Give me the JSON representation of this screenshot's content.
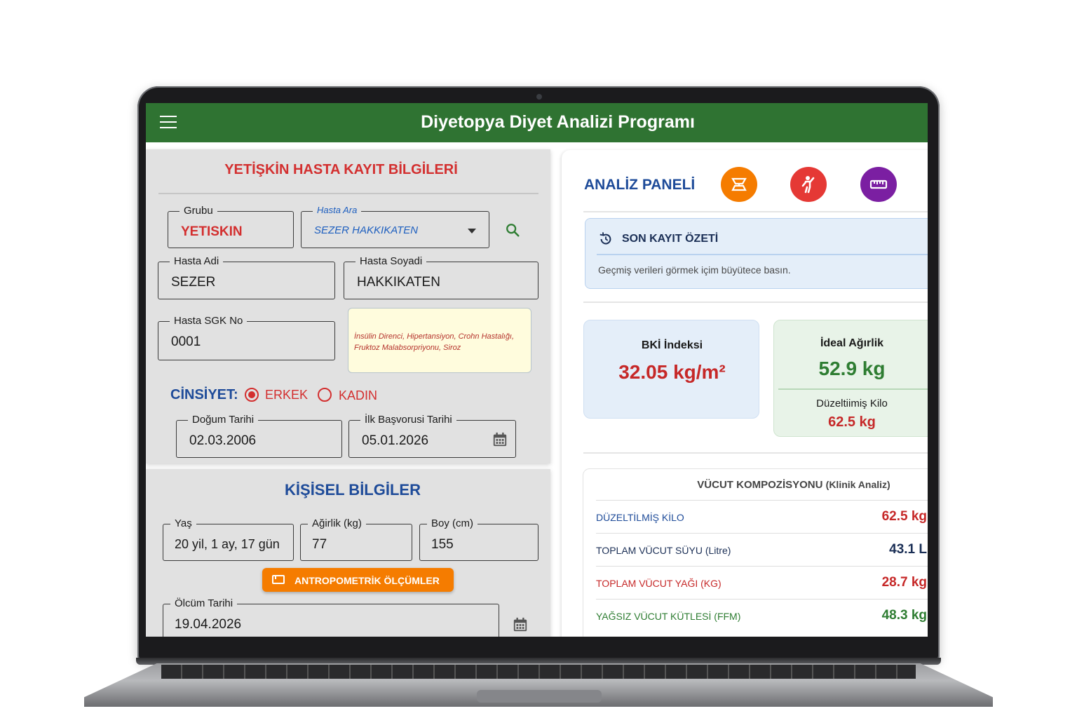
{
  "app": {
    "title": "Diyetopya Diyet Analizi Programı"
  },
  "patient_form": {
    "title": "YETİŞKİN HASTA KAYIT BİLGİLERİ",
    "group": {
      "label": "Grubu",
      "value": "YETISKIN"
    },
    "search": {
      "label": "Hasta Ara",
      "value": "SEZER HAKKIKATEN"
    },
    "first_name": {
      "label": "Hasta Adi",
      "value": "SEZER"
    },
    "last_name": {
      "label": "Hasta Soyadi",
      "value": "HAKKIKATEN"
    },
    "sgk_no": {
      "label": "Hasta SGK No",
      "value": "0001"
    },
    "conditions_note": "İnsülin Direnci, Hipertansiyon, Crohn Hastalığı, Fruktoz Malabsorpriyonu, Siroz",
    "gender": {
      "label": "CİNSİYET:",
      "options": [
        "ERKEK",
        "KADIN"
      ],
      "selected": "ERKEK"
    },
    "birth_date": {
      "label": "Doğum Tarihi",
      "value": "02.03.2006"
    },
    "first_visit": {
      "label": "İlk Başvorusi Tarihi",
      "value": "05.01.2026"
    }
  },
  "personal": {
    "title": "KİŞİSEL BİLGİLER",
    "age": {
      "label": "Yaş",
      "value": "20 yil, 1 ay, 17 gün"
    },
    "weight": {
      "label": "Ağirlik (kg)",
      "value": "77"
    },
    "height": {
      "label": "Boy (cm)",
      "value": "155"
    },
    "anthro_button": "ANTROPOMETRİK ÖLÇÜMLER",
    "measure_date": {
      "label": "Ölcüm Tarihi",
      "value": "19.04.2026"
    }
  },
  "analysis": {
    "title": "ANALİZ PANELİ",
    "icons": [
      {
        "name": "scale-icon",
        "color": "#f57c00"
      },
      {
        "name": "person-icon",
        "color": "#e53935"
      },
      {
        "name": "ruler-icon",
        "color": "#7b1fa2"
      }
    ],
    "summary": {
      "title": "SON KAYIT ÖZETİ",
      "text": "Geçmiş verileri görmek içim büyütece basın."
    },
    "bmi": {
      "label": "BKİ İndeksi",
      "value": "32.05 kg/m²"
    },
    "ideal": {
      "label": "İdeal Ağırlik",
      "value": "52.9 kg",
      "adj_label": "Düzeltiimiş Kilo",
      "adj_value": "62.5 kg"
    },
    "composition": {
      "title": "VÜCUT KOMPOZİSYONU",
      "subtitle": "(Klinik Analiz)",
      "rows": [
        {
          "key": "DÜZELTİLMİŞ KİLO",
          "value": "62.5 kg"
        },
        {
          "key": "TOPLAM VÜCUT SÜYU (Litre)",
          "value": "43.1 L"
        },
        {
          "key": "TOPLAM VÜCUT YAĞI (KG)",
          "value": "28.7 kg"
        },
        {
          "key": "YAĞSIZ VÜCUT KÜTLESİ (FFM)",
          "value": "48.3 kg"
        }
      ]
    }
  }
}
